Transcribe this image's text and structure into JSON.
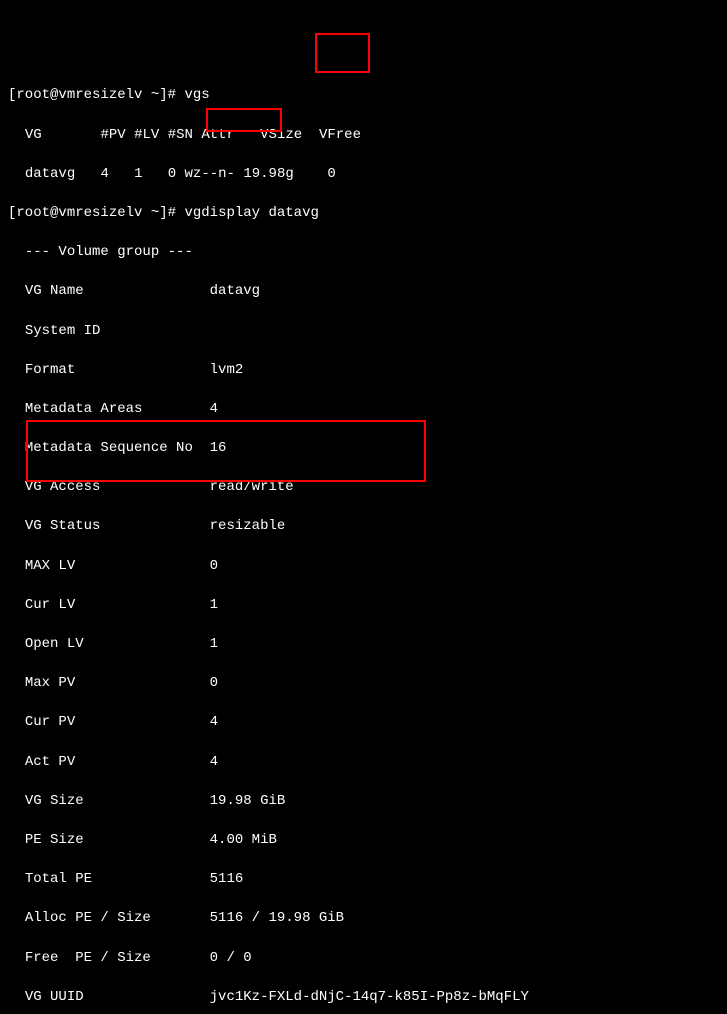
{
  "prompt1": {
    "user": "root",
    "host": "vmresizelv",
    "path": "~",
    "symbol": "#",
    "cmd": "vgs"
  },
  "vgs": {
    "header": {
      "vg": "VG",
      "pv": "#PV",
      "lv": "#LV",
      "sn": "#SN",
      "attr": "Attr",
      "vsize": "VSize",
      "vfree": "VFree"
    },
    "row": {
      "vg": "datavg",
      "pv": "4",
      "lv": "1",
      "sn": "0",
      "attr": "wz--n-",
      "vsize": "19.98g",
      "vfree": "0"
    }
  },
  "prompt2": {
    "user": "root",
    "host": "vmresizelv",
    "path": "~",
    "symbol": "#",
    "cmd": "vgdisplay datavg"
  },
  "vgdisplay": {
    "header": "--- Volume group ---",
    "fields": {
      "vg_name_label": "VG Name",
      "vg_name_value": "datavg",
      "system_id_label": "System ID",
      "system_id_value": "",
      "format_label": "Format",
      "format_value": "lvm2",
      "metadata_areas_label": "Metadata Areas",
      "metadata_areas_value": "4",
      "metadata_seq_label": "Metadata Sequence No",
      "metadata_seq_value": "16",
      "vg_access_label": "VG Access",
      "vg_access_value": "read/write",
      "vg_status_label": "VG Status",
      "vg_status_value": "resizable",
      "max_lv_label": "MAX LV",
      "max_lv_value": "0",
      "cur_lv_label": "Cur LV",
      "cur_lv_value": "1",
      "open_lv_label": "Open LV",
      "open_lv_value": "1",
      "max_pv_label": "Max PV",
      "max_pv_value": "0",
      "cur_pv_label": "Cur PV",
      "cur_pv_value": "4",
      "act_pv_label": "Act PV",
      "act_pv_value": "4",
      "vg_size_label": "VG Size",
      "vg_size_value": "19.98 GiB",
      "pe_size_label": "PE Size",
      "pe_size_value": "4.00 MiB",
      "total_pe_label": "Total PE",
      "total_pe_value": "5116",
      "alloc_pe_label": "Alloc PE / Size",
      "alloc_pe_value": "5116 / 19.98 GiB",
      "free_pe_label": "Free  PE / Size",
      "free_pe_value": "0 / 0",
      "vg_uuid_label": "VG UUID",
      "vg_uuid_value": "jvc1Kz-FXLd-dNjC-14q7-k85I-Pp8z-bMqFLY"
    }
  },
  "highlight_colors": {
    "box": "#ff0000"
  }
}
